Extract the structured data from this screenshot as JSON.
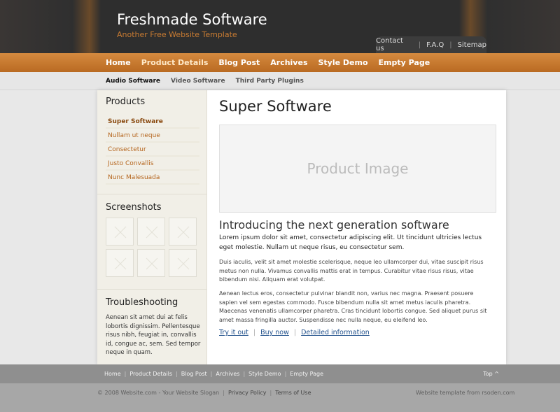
{
  "header": {
    "title": "Freshmade Software",
    "slogan": "Another Free Website Template",
    "top_links": [
      "Contact us",
      "F.A.Q",
      "Sitemap"
    ]
  },
  "nav": {
    "items": [
      "Home",
      "Product Details",
      "Blog Post",
      "Archives",
      "Style Demo",
      "Empty Page"
    ],
    "active": "Product Details"
  },
  "subnav": {
    "items": [
      "Audio Software",
      "Video Software",
      "Third Party Plugins"
    ],
    "active": "Audio Software"
  },
  "sidebar": {
    "products_title": "Products",
    "products": [
      "Super Software",
      "Nullam ut neque",
      "Consectetur",
      "Justo Convallis",
      "Nunc Malesuada"
    ],
    "screenshots_title": "Screenshots",
    "troubleshooting_title": "Troubleshooting",
    "troubleshooting_text": "Aenean sit amet dui at felis lobortis dignissim. Pellentesque risus nibh, feugiat in, convallis id, congue ac, sem. Sed tempor neque in quam."
  },
  "content": {
    "title": "Super Software",
    "image_placeholder": "Product Image",
    "intro_title": "Introducing the next generation software",
    "lead": "Lorem ipsum dolor sit amet, consectetur adipiscing elit. Ut tincidunt ultricies lectus eget molestie. Nullam ut neque risus, eu consectetur sem.",
    "para1": "Duis iaculis, velit sit amet molestie scelerisque, neque leo ullamcorper dui, vitae suscipit risus metus non nulla. Vivamus convallis mattis erat in tempus. Curabitur vitae risus risus, vitae bibendum nisi. Aliquam erat volutpat.",
    "para2": "Aenean lectus eros, consectetur pulvinar blandit non, varius nec magna. Praesent posuere sapien vel sem egestas commodo. Fusce bibendum nulla sit amet metus iaculis pharetra. Maecenas venenatis ullamcorper pharetra. Cras tincidunt lobortis congue. Sed aliquet purus sit amet massa fringilla auctor. Suspendisse nec nulla neque, eu eleifend leo.",
    "links": [
      "Try it out",
      "Buy now",
      "Detailed information"
    ]
  },
  "footer": {
    "nav": [
      "Home",
      "Product Details",
      "Blog Post",
      "Archives",
      "Style Demo",
      "Empty Page"
    ],
    "top": "Top ^",
    "copyright": "© 2008 Website.com - Your Website Slogan",
    "privacy": "Privacy Policy",
    "terms": "Terms of Use",
    "credit": "Website template from rsoden.com"
  },
  "colors": {
    "accent": "#c87b32",
    "nav": "#c77a30",
    "header": "#2e2e2e",
    "link": "#1f4f8a"
  }
}
